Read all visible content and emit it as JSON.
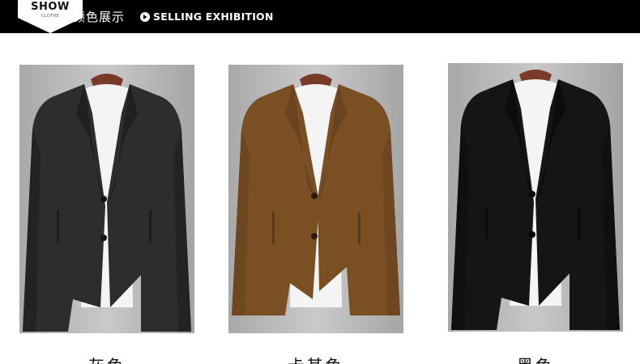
{
  "header": {
    "badge_title": "SHOW",
    "badge_subtitle": "CLOTHE",
    "title_cn": "颜色展示",
    "arrow_icon": "circle-arrow-right-icon",
    "title_en": "SELLING EXHIBITION"
  },
  "colors": {
    "header_bg": "#000000",
    "gray_coat": "#2c2d2f",
    "brown_coat": "#7a4f24",
    "black_coat": "#151515",
    "backdrop": "#b8b8b8"
  },
  "products": [
    {
      "label": "灰色",
      "coat_color": "#2c2d2f"
    },
    {
      "label": "卡其色",
      "coat_color": "#7a4f24"
    },
    {
      "label": "黑色",
      "coat_color": "#151515"
    }
  ]
}
